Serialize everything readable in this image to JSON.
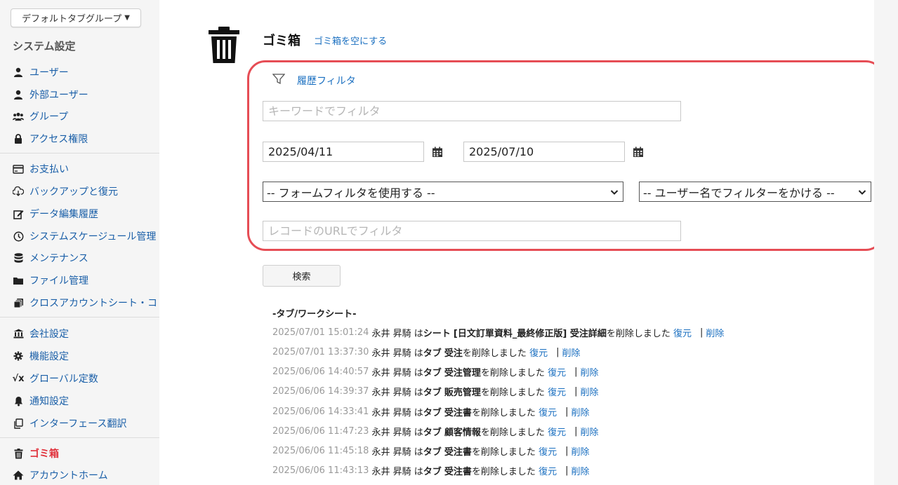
{
  "sidebar": {
    "tab_group_label": "デフォルトタブグループ",
    "section_title": "システム設定",
    "items": [
      {
        "label": "ユーザー",
        "icon": "user-icon"
      },
      {
        "label": "外部ユーザー",
        "icon": "user-icon"
      },
      {
        "label": "グループ",
        "icon": "users-icon"
      },
      {
        "label": "アクセス権限",
        "icon": "lock-icon"
      },
      {
        "label": "お支払い",
        "icon": "credit-card-icon"
      },
      {
        "label": "バックアップと復元",
        "icon": "cloud-download-icon"
      },
      {
        "label": "データ編集履歴",
        "icon": "edit-icon"
      },
      {
        "label": "システムスケージュール管理",
        "icon": "clock-icon"
      },
      {
        "label": "メンテナンス",
        "icon": "database-icon"
      },
      {
        "label": "ファイル管理",
        "icon": "folder-icon"
      },
      {
        "label": "クロスアカウントシート・コ",
        "icon": "stack-icon"
      },
      {
        "label": "会社設定",
        "icon": "bank-icon"
      },
      {
        "label": "機能設定",
        "icon": "gear-icon"
      },
      {
        "label": "グローバル定数",
        "icon": "sqrt-x-icon"
      },
      {
        "label": "通知設定",
        "icon": "bell-icon"
      },
      {
        "label": "インターフェース翻訳",
        "icon": "copy-icon"
      },
      {
        "label": "ゴミ箱",
        "icon": "trash-icon",
        "active": true
      },
      {
        "label": "アカウントホーム",
        "icon": "home-icon"
      }
    ]
  },
  "main": {
    "title": "ゴミ箱",
    "empty_trash_label": "ゴミ箱を空にする",
    "filter": {
      "title": "履歴フィルタ",
      "keyword_placeholder": "キーワードでフィルタ",
      "date_from": "2025/04/11",
      "date_to": "2025/07/10",
      "form_filter": "-- フォームフィルタを使用する --",
      "user_filter": "-- ユーザー名でフィルターをかける --",
      "url_placeholder": "レコードのURLでフィルタ"
    },
    "search_label": "検索",
    "log_heading": "-タブ/ワークシート-",
    "logs": [
      {
        "time": "2025/07/01 15:01:24",
        "user": "永井 昇騎",
        "mid": "は",
        "type": "シート",
        "name": "[日文訂單資料_最終修正版] 受注詳細",
        "suffix": "を削除しました",
        "restore": "復元",
        "delete": "削除"
      },
      {
        "time": "2025/07/01 13:37:30",
        "user": "永井 昇騎",
        "mid": "は",
        "type": "タブ",
        "name": "受注",
        "suffix": "を削除しました",
        "restore": "復元",
        "delete": "削除"
      },
      {
        "time": "2025/06/06 14:40:57",
        "user": "永井 昇騎",
        "mid": "は",
        "type": "タブ",
        "name": "受注管理",
        "suffix": "を削除しました",
        "restore": "復元",
        "delete": "削除"
      },
      {
        "time": "2025/06/06 14:39:37",
        "user": "永井 昇騎",
        "mid": "は",
        "type": "タブ",
        "name": "販売管理",
        "suffix": "を削除しました",
        "restore": "復元",
        "delete": "削除"
      },
      {
        "time": "2025/06/06 14:33:41",
        "user": "永井 昇騎",
        "mid": "は",
        "type": "タブ",
        "name": "受注書",
        "suffix": "を削除しました",
        "restore": "復元",
        "delete": "削除"
      },
      {
        "time": "2025/06/06 11:47:23",
        "user": "永井 昇騎",
        "mid": "は",
        "type": "タブ",
        "name": "顧客情報",
        "suffix": "を削除しました",
        "restore": "復元",
        "delete": "削除"
      },
      {
        "time": "2025/06/06 11:45:18",
        "user": "永井 昇騎",
        "mid": "は",
        "type": "タブ",
        "name": "受注書",
        "suffix": "を削除しました",
        "restore": "復元",
        "delete": "削除"
      },
      {
        "time": "2025/06/06 11:43:13",
        "user": "永井 昇騎",
        "mid": "は",
        "type": "タブ",
        "name": "受注書",
        "suffix": "を削除しました",
        "restore": "復元",
        "delete": "削除"
      }
    ]
  },
  "colors": {
    "link": "#1a6fc0",
    "active": "#e0303a",
    "highlight_border": "#e64d55"
  }
}
